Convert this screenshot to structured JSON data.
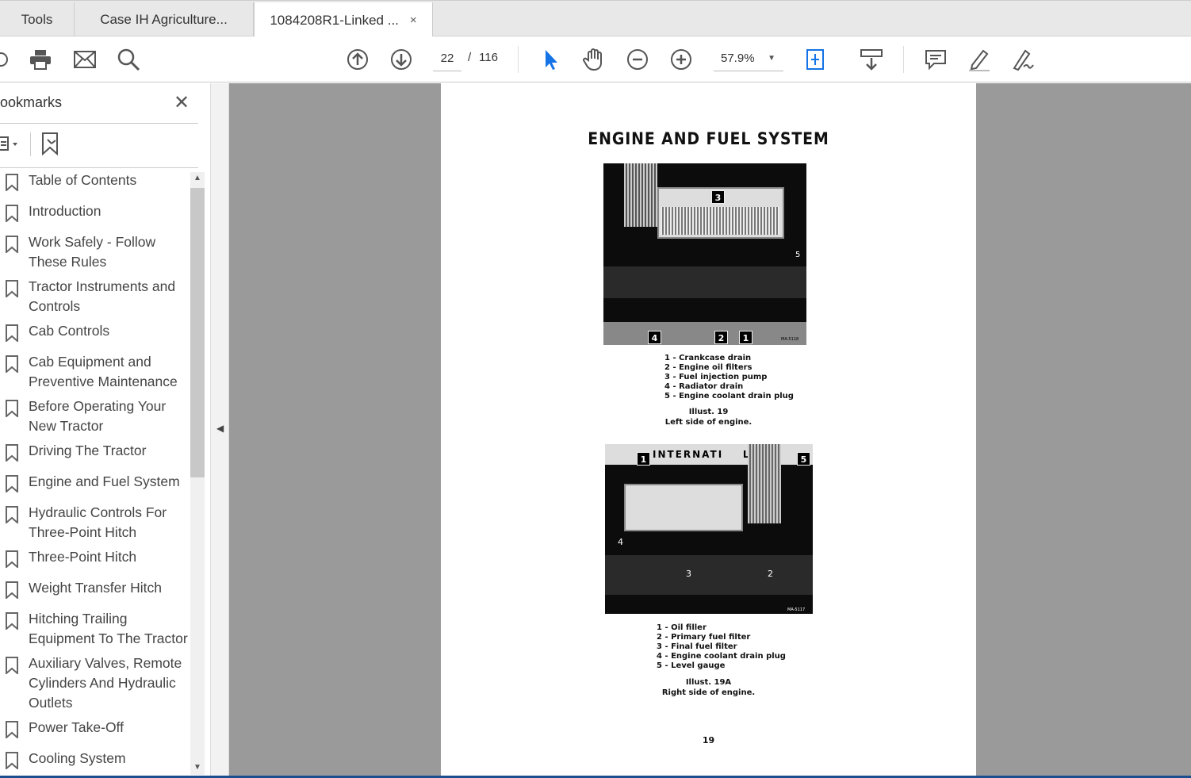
{
  "tabs": [
    {
      "label": "Tools"
    },
    {
      "label": "Case IH Agriculture..."
    },
    {
      "label": "1084208R1-Linked ...",
      "close": "×"
    }
  ],
  "toolbar": {
    "page_current": "22",
    "page_sep": "/",
    "page_total": "116",
    "zoom": "57.9%"
  },
  "sidebar": {
    "title": "ookmarks",
    "close": "✕",
    "items": [
      {
        "label": "Table of Contents"
      },
      {
        "label": "Introduction"
      },
      {
        "label": "Work Safely - Follow These Rules"
      },
      {
        "label": "Tractor Instruments and Controls"
      },
      {
        "label": "Cab Controls"
      },
      {
        "label": "Cab Equipment and Preventive Maintenance"
      },
      {
        "label": "Before Operating Your New Tractor"
      },
      {
        "label": "Driving The Tractor"
      },
      {
        "label": "Engine and Fuel System"
      },
      {
        "label": "Hydraulic Controls For Three-Point Hitch"
      },
      {
        "label": "Three-Point Hitch"
      },
      {
        "label": "Weight Transfer Hitch"
      },
      {
        "label": "Hitching Trailing Equipment To The Tractor"
      },
      {
        "label": "Auxiliary Valves, Remote Cylinders And Hydraulic Outlets"
      },
      {
        "label": "Power Take-Off"
      },
      {
        "label": "Cooling System"
      }
    ]
  },
  "document": {
    "title": "ENGINE AND FUEL SYSTEM",
    "illust1": {
      "callouts": [
        "3",
        "5",
        "4",
        "2",
        "1"
      ],
      "code": "MA-5118",
      "legend": [
        "1 - Crankcase drain",
        "2 - Engine oil filters",
        "3 - Fuel injection pump",
        "4 - Radiator drain",
        "5 - Engine coolant drain plug"
      ],
      "caption": "Illust. 19",
      "subcaption": "Left side of engine."
    },
    "illust2": {
      "callouts": [
        "1",
        "5",
        "4",
        "3",
        "2"
      ],
      "code": "MA-5117",
      "emblem": "INTERNATI    L",
      "legend": [
        "1 - Oil filler",
        "2 - Primary fuel filter",
        "3 - Final fuel filter",
        "4 - Engine coolant drain plug",
        "5 - Level gauge"
      ],
      "caption": "Illust. 19A",
      "subcaption": "Right side of engine."
    },
    "page_number": "19"
  }
}
